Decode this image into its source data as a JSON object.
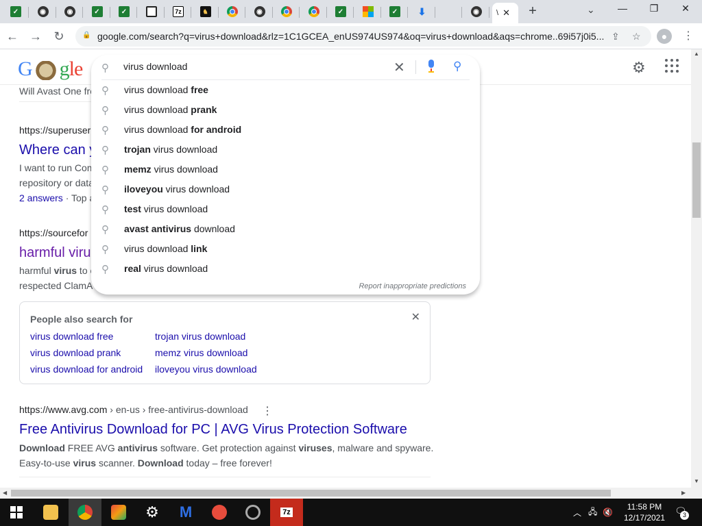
{
  "browser": {
    "tabs": [
      {
        "icon": "green-square-icon"
      },
      {
        "icon": "github-icon"
      },
      {
        "icon": "github-icon"
      },
      {
        "icon": "green-square-icon"
      },
      {
        "icon": "green-square-icon"
      },
      {
        "icon": "square-outline-icon"
      },
      {
        "icon": "7zip-icon"
      },
      {
        "icon": "red-bull-icon"
      },
      {
        "icon": "chrome-icon"
      },
      {
        "icon": "github-icon"
      },
      {
        "icon": "chrome-icon"
      },
      {
        "icon": "chrome-icon"
      },
      {
        "icon": "green-square-icon"
      },
      {
        "icon": "microsoft-icon"
      },
      {
        "icon": "green-square-icon"
      },
      {
        "icon": "download-icon"
      },
      {
        "icon": "apple-icon"
      },
      {
        "icon": "github-icon"
      }
    ],
    "active_tab_label": "\\",
    "url": "google.com/search?q=virus+download&rlz=1C1GCEA_enUS974US974&oq=virus+download&aqs=chrome..69i57j0i5...",
    "new_tab": "+",
    "minimize": "—",
    "restore": "❐",
    "close": "✕"
  },
  "search": {
    "query": "virus download",
    "suggestions": [
      {
        "plain_before": "virus download ",
        "bold": "free",
        "plain_after": ""
      },
      {
        "plain_before": "virus download ",
        "bold": "prank",
        "plain_after": ""
      },
      {
        "plain_before": "virus download ",
        "bold": "for android",
        "plain_after": ""
      },
      {
        "plain_before": "",
        "bold": "trojan",
        "plain_after": " virus download"
      },
      {
        "plain_before": "",
        "bold": "memz",
        "plain_after": " virus download"
      },
      {
        "plain_before": "",
        "bold": "iloveyou",
        "plain_after": " virus download"
      },
      {
        "plain_before": "",
        "bold": "test",
        "plain_after": " virus download"
      },
      {
        "plain_before": "",
        "bold": "avast antivirus",
        "plain_after": " download"
      },
      {
        "plain_before": "virus download ",
        "bold": "link",
        "plain_after": ""
      },
      {
        "plain_before": "",
        "bold": "real",
        "plain_after": " virus download"
      }
    ],
    "report_text": "Report inappropriate predictions"
  },
  "results": {
    "top_snippet": "Will Avast One fre",
    "r1_cite": "https://superuser",
    "r1_title": "Where can y",
    "r1_snip1": "I want to run Com",
    "r1_snip2": "repository or data",
    "r1_answers": "2 answers",
    "r1_top": " · Top a",
    "r2_cite": "https://sourcefor",
    "r2_title": "harmful viru",
    "r2_snip1_a": "harmful ",
    "r2_snip1_b": "virus",
    "r2_snip1_c": " to c",
    "r2_snip2": "respected ClamA",
    "r3_cite_domain": "https://www.avg.com",
    "r3_cite_path": " › en-us › free-antivirus-download",
    "r3_title": "Free Antivirus Download for PC | AVG Virus Protection Software",
    "r3_snip1": [
      {
        "t": "Download",
        "b": true
      },
      {
        "t": " FREE AVG ",
        "b": false
      },
      {
        "t": "antivirus",
        "b": true
      },
      {
        "t": " software. Get protection against ",
        "b": false
      },
      {
        "t": "viruses",
        "b": true
      },
      {
        "t": ", malware and spyware.",
        "b": false
      }
    ],
    "r3_snip2": [
      {
        "t": "Easy-to-use ",
        "b": false
      },
      {
        "t": "virus",
        "b": true
      },
      {
        "t": " scanner. ",
        "b": false
      },
      {
        "t": "Download",
        "b": true
      },
      {
        "t": " today – free forever!",
        "b": false
      }
    ]
  },
  "people_also_search": {
    "title": "People also search for",
    "col1": [
      "virus download free",
      "virus download prank",
      "virus download for android"
    ],
    "col2": [
      "trojan virus download",
      "memz virus download",
      "iloveyou virus download"
    ]
  },
  "taskbar": {
    "time": "11:58 PM",
    "date": "12/17/2021",
    "notifications": "3",
    "zip_label": "7z"
  }
}
